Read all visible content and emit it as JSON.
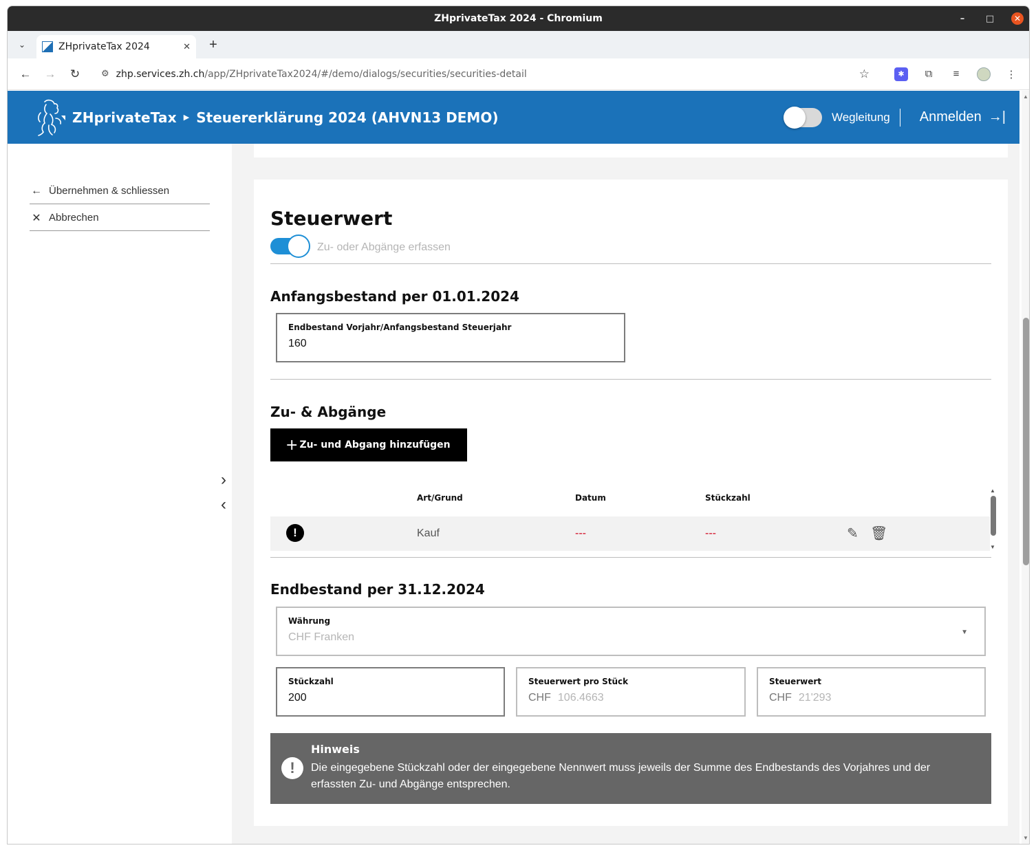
{
  "window": {
    "title": "ZHprivateTax 2024 - Chromium",
    "minimize": "–",
    "maximize": "□",
    "close": "✕"
  },
  "browser": {
    "tab_title": "ZHprivateTax 2024",
    "tab_close": "✕",
    "new_tab": "+",
    "tab_dropdown": "⌄",
    "url_host": "zhp.services.zh.ch",
    "url_path": "/app/ZHprivateTax2024/#/demo/dialogs/securities/securities-detail"
  },
  "header": {
    "brand": "ZHprivateTax",
    "title": "Steuererklärung 2024 (AHVN13 DEMO)",
    "guidance_label": "Wegleitung",
    "guidance_on": false,
    "login_label": "Anmelden"
  },
  "sidebar": {
    "accept_label": "Übernehmen & schliessen",
    "cancel_label": "Abbrechen"
  },
  "main": {
    "section_title": "Steuerwert",
    "changes_toggle_label": "Zu- oder Abgänge erfassen",
    "changes_toggle_on": true,
    "opening": {
      "heading": "Anfangsbestand per 01.01.2024",
      "field_label": "Endbestand Vorjahr/Anfangsbestand Steuerjahr",
      "field_value": "160"
    },
    "changes": {
      "heading": "Zu- & Abgänge",
      "add_button": "Zu- und Abgang hinzufügen",
      "columns": [
        "Art/Grund",
        "Datum",
        "Stückzahl"
      ],
      "rows": [
        {
          "art": "Kauf",
          "datum": "---",
          "stueckzahl": "---",
          "warning": "!"
        }
      ]
    },
    "closing": {
      "heading": "Endbestand per 31.12.2024",
      "currency_label": "Währung",
      "currency_value": "CHF Franken",
      "quantity_label": "Stückzahl",
      "quantity_value": "200",
      "unit_value_label": "Steuerwert pro Stück",
      "unit_value_currency": "CHF",
      "unit_value": "106.4663",
      "tax_value_label": "Steuerwert",
      "tax_value_currency": "CHF",
      "tax_value": "21'293"
    },
    "notice": {
      "title": "Hinweis",
      "text": "Die eingegebene Stückzahl oder der eingegebene Nennwert muss jeweils der Summe des Endbestands des Vorjahres und der erfassten Zu- und Abgänge entsprechen."
    }
  },
  "colors": {
    "header_blue": "#1b72b9",
    "toggle_blue": "#1e8fd6",
    "notice_gray": "#666666",
    "error_red": "#d0021b"
  }
}
